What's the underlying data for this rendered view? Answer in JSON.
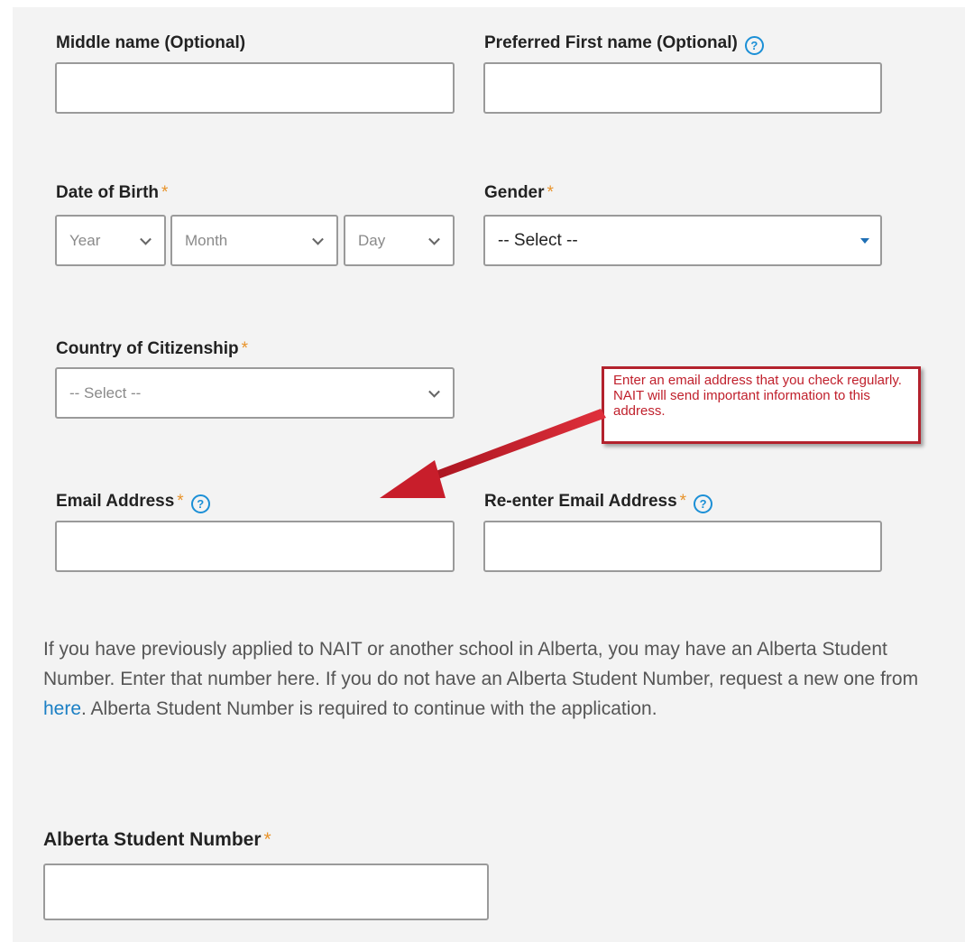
{
  "form": {
    "middle_name": {
      "label": "Middle name (Optional)",
      "value": ""
    },
    "preferred_first_name": {
      "label": "Preferred First name (Optional)",
      "value": ""
    },
    "date_of_birth": {
      "label": "Date of Birth",
      "year_placeholder": "Year",
      "month_placeholder": "Month",
      "day_placeholder": "Day"
    },
    "gender": {
      "label": "Gender",
      "selected": "-- Select --"
    },
    "country": {
      "label": "Country of Citizenship",
      "selected": "-- Select --"
    },
    "email": {
      "label": "Email Address",
      "value": ""
    },
    "email_confirm": {
      "label": "Re-enter Email Address",
      "value": ""
    },
    "required_mark": "*",
    "help_glyph": "?"
  },
  "callout": {
    "text": "Enter an email address that you check regularly. NAIT will send important information to this address."
  },
  "info": {
    "text_before": "If you have previously applied to NAIT or another school in Alberta, you may have an Alberta Student Number. Enter that number here. If you do not have an Alberta Student Number, request a new one from ",
    "link": "here",
    "text_after": ". Alberta Student Number is required to continue with the application."
  },
  "asn": {
    "label": "Alberta Student Number",
    "value": ""
  },
  "colors": {
    "required": "#e8932a",
    "help": "#1b8fd6",
    "link": "#1a7fc4",
    "callout_border": "#b3222d",
    "callout_text": "#c0202c",
    "arrow": "#c81e2b",
    "panel_bg": "#f3f3f3"
  },
  "icons": {
    "help": "question-circle-icon",
    "dropdown": "chevron-down-icon",
    "caret": "caret-down-icon",
    "arrow": "arrow-icon"
  }
}
